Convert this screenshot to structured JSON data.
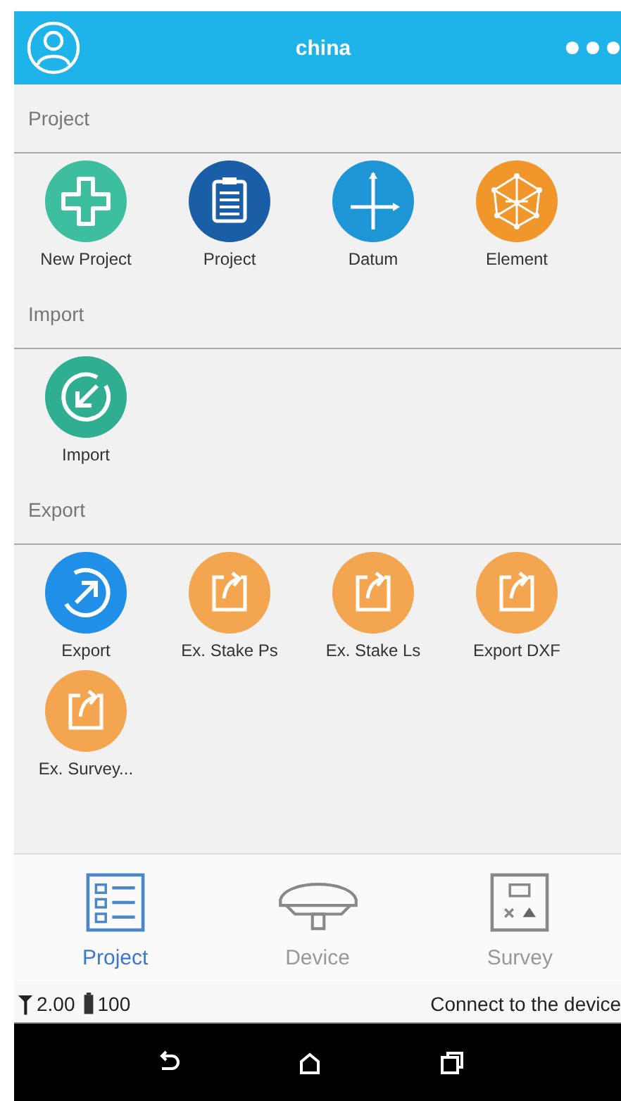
{
  "header": {
    "title": "china"
  },
  "sections": [
    {
      "label": "Project",
      "items": [
        {
          "label": "New Project",
          "kind": "new"
        },
        {
          "label": "Project",
          "kind": "project"
        },
        {
          "label": "Datum",
          "kind": "datum"
        },
        {
          "label": "Element",
          "kind": "element"
        }
      ]
    },
    {
      "label": "Import",
      "items": [
        {
          "label": "Import",
          "kind": "import"
        }
      ]
    },
    {
      "label": "Export",
      "items": [
        {
          "label": "Export",
          "kind": "export"
        },
        {
          "label": "Ex. Stake Ps",
          "kind": "file"
        },
        {
          "label": "Ex. Stake Ls",
          "kind": "file"
        },
        {
          "label": "Export DXF",
          "kind": "file"
        },
        {
          "label": "Ex. Survey...",
          "kind": "file"
        }
      ]
    }
  ],
  "tabs": [
    {
      "label": "Project",
      "kind": "project",
      "selected": true
    },
    {
      "label": "Device",
      "kind": "device",
      "selected": false
    },
    {
      "label": "Survey",
      "kind": "survey",
      "selected": false
    }
  ],
  "status_bar": {
    "signal": "2.00",
    "battery": "100",
    "message": "Connect to the device"
  }
}
